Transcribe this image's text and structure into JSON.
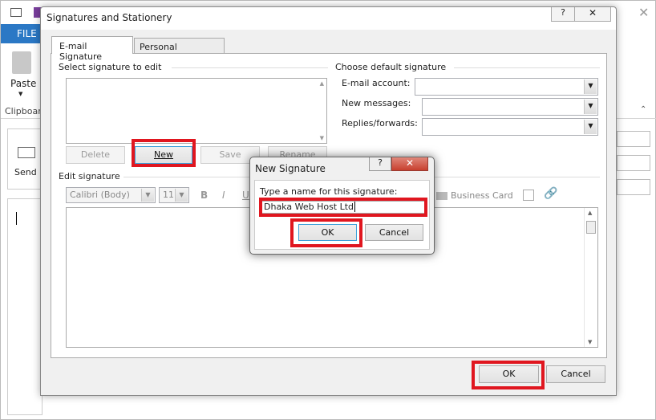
{
  "outlook": {
    "file_tab": "FILE",
    "paste_label": "Paste",
    "clipboard_group": "Clipboard",
    "send_label": "Send",
    "accent": "#2b78c5"
  },
  "dialog": {
    "title": "Signatures and Stationery",
    "tabs": [
      {
        "label": "E-mail Signature",
        "active": true
      },
      {
        "label": "Personal Stationery",
        "active": false
      }
    ],
    "select_label": "Select signature to edit",
    "buttons": {
      "delete": "Delete",
      "new": "New",
      "save": "Save",
      "rename": "Rename"
    },
    "choose_default": "Choose default signature",
    "email_account_label": "E-mail account:",
    "new_messages_label": "New messages:",
    "replies_label": "Replies/forwards:",
    "email_account_value": "",
    "new_messages_value": "",
    "replies_value": "",
    "edit_label": "Edit signature",
    "font": "Calibri (Body)",
    "size": "11",
    "format": {
      "bold": "B",
      "italic": "I",
      "underline": "U"
    },
    "business_card": "Business Card",
    "ok": "OK",
    "cancel": "Cancel"
  },
  "new_signature": {
    "title": "New Signature",
    "prompt": "Type a name for this signature:",
    "value": "Dhaka Web Host Ltd",
    "ok": "OK",
    "cancel": "Cancel"
  },
  "highlight_color": "#e0161f"
}
